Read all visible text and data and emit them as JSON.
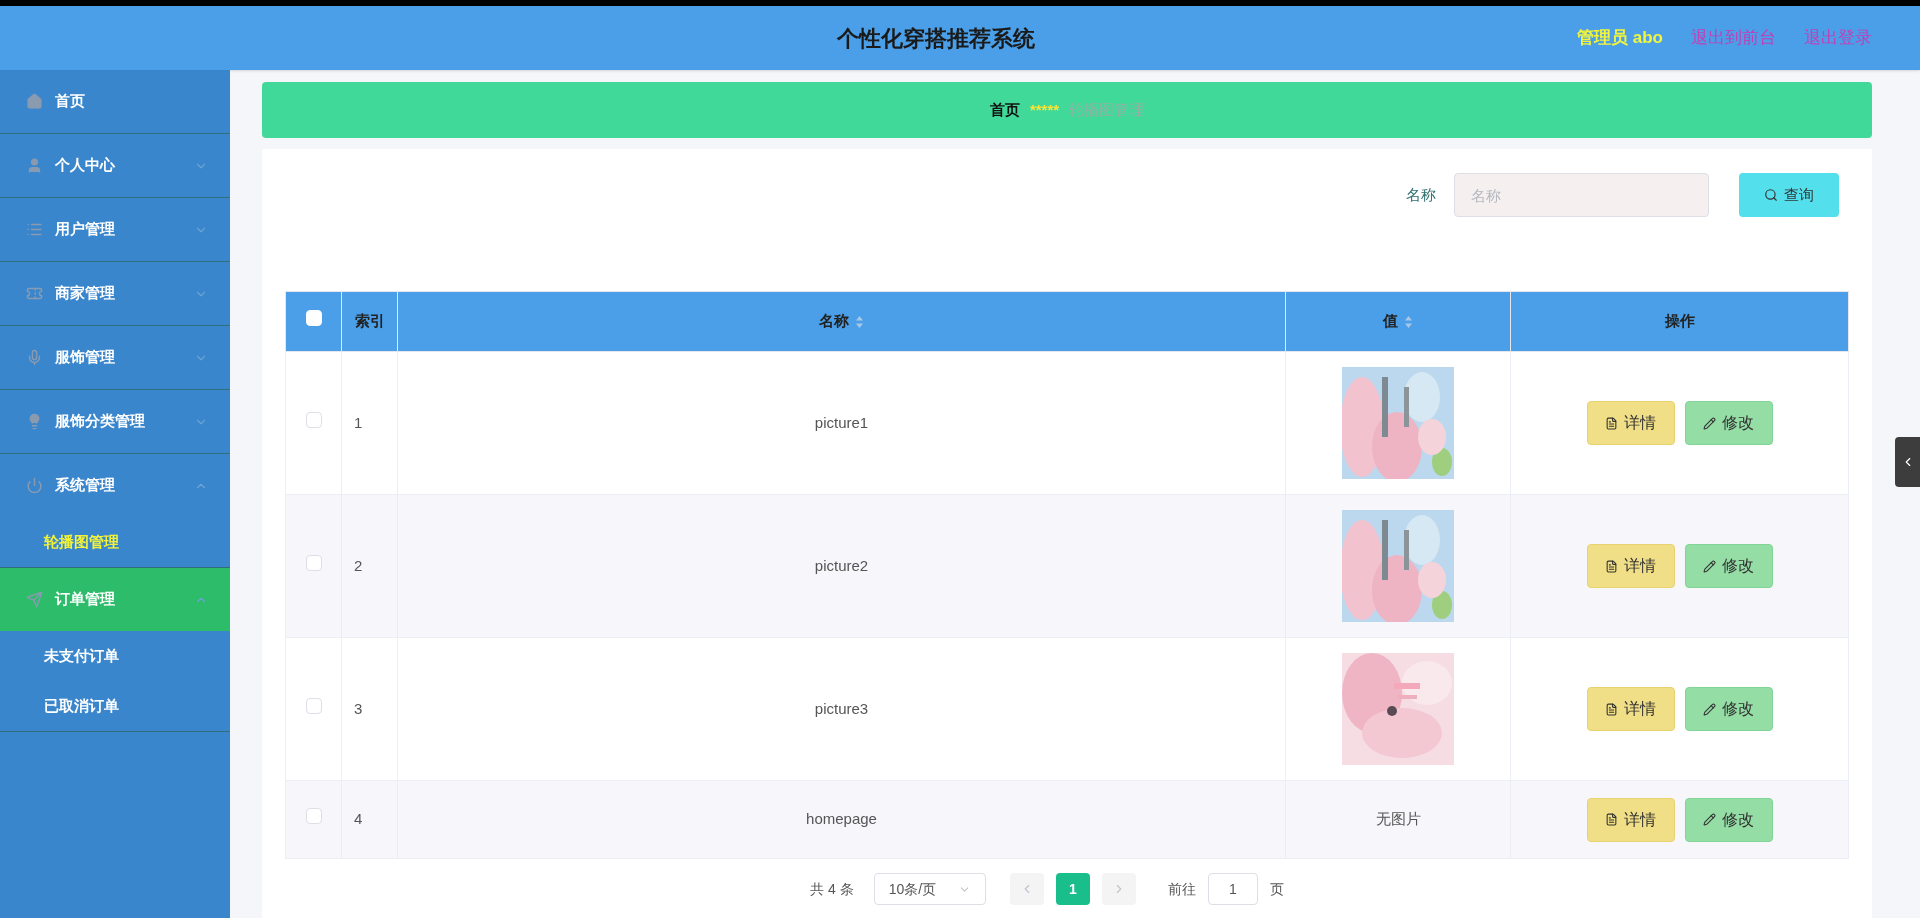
{
  "header": {
    "title": "个性化穿搭推荐系统",
    "user": "管理员 abo",
    "links": [
      "退出到前台",
      "退出登录"
    ]
  },
  "sidebar": {
    "items": [
      {
        "label": "首页",
        "hovered": false
      },
      {
        "label": "个人中心",
        "expanded": false,
        "hovered": false
      },
      {
        "label": "用户管理",
        "expanded": false,
        "hovered": false
      },
      {
        "label": "商家管理",
        "expanded": false,
        "hovered": false
      },
      {
        "label": "服饰管理",
        "expanded": false,
        "hovered": false
      },
      {
        "label": "服饰分类管理",
        "expanded": false,
        "hovered": false
      },
      {
        "label": "系统管理",
        "expanded": true,
        "hovered": false,
        "children": [
          {
            "label": "轮播图管理",
            "selected": true
          }
        ]
      },
      {
        "label": "订单管理",
        "expanded": true,
        "hovered": true,
        "children": [
          {
            "label": "未支付订单",
            "selected": false
          },
          {
            "label": "已取消订单",
            "selected": false
          }
        ]
      }
    ]
  },
  "breadcrumb": {
    "home": "首页",
    "separator": "*****",
    "current": "轮播图管理"
  },
  "search": {
    "label": "名称",
    "placeholder": "名称",
    "button": "查询"
  },
  "table": {
    "header_checkbox": {
      "checked": false
    },
    "columns": [
      {
        "label": "索引",
        "sortable": false
      },
      {
        "label": "名称",
        "sortable": true
      },
      {
        "label": "值",
        "sortable": true
      },
      {
        "label": "操作",
        "sortable": false
      }
    ],
    "rows": [
      {
        "checked": false,
        "index": "1",
        "name": "picture1",
        "actions": [
          "详情",
          "修改"
        ]
      },
      {
        "checked": false,
        "index": "2",
        "name": "picture2",
        "actions": [
          "详情",
          "修改"
        ]
      },
      {
        "checked": false,
        "index": "3",
        "name": "picture3",
        "actions": [
          "详情",
          "修改"
        ]
      },
      {
        "checked": false,
        "index": "4",
        "name": "homepage",
        "value": {
          "kind": "text",
          "text": "无图片"
        },
        "actions": [
          "详情",
          "修改"
        ]
      }
    ]
  },
  "pagination": {
    "total": "共 4 条",
    "page_size": "10条/页",
    "pages": [
      {
        "label": "1",
        "selected": true
      }
    ],
    "goto_label": "前往",
    "goto_value": "1",
    "page_unit": "页"
  }
}
